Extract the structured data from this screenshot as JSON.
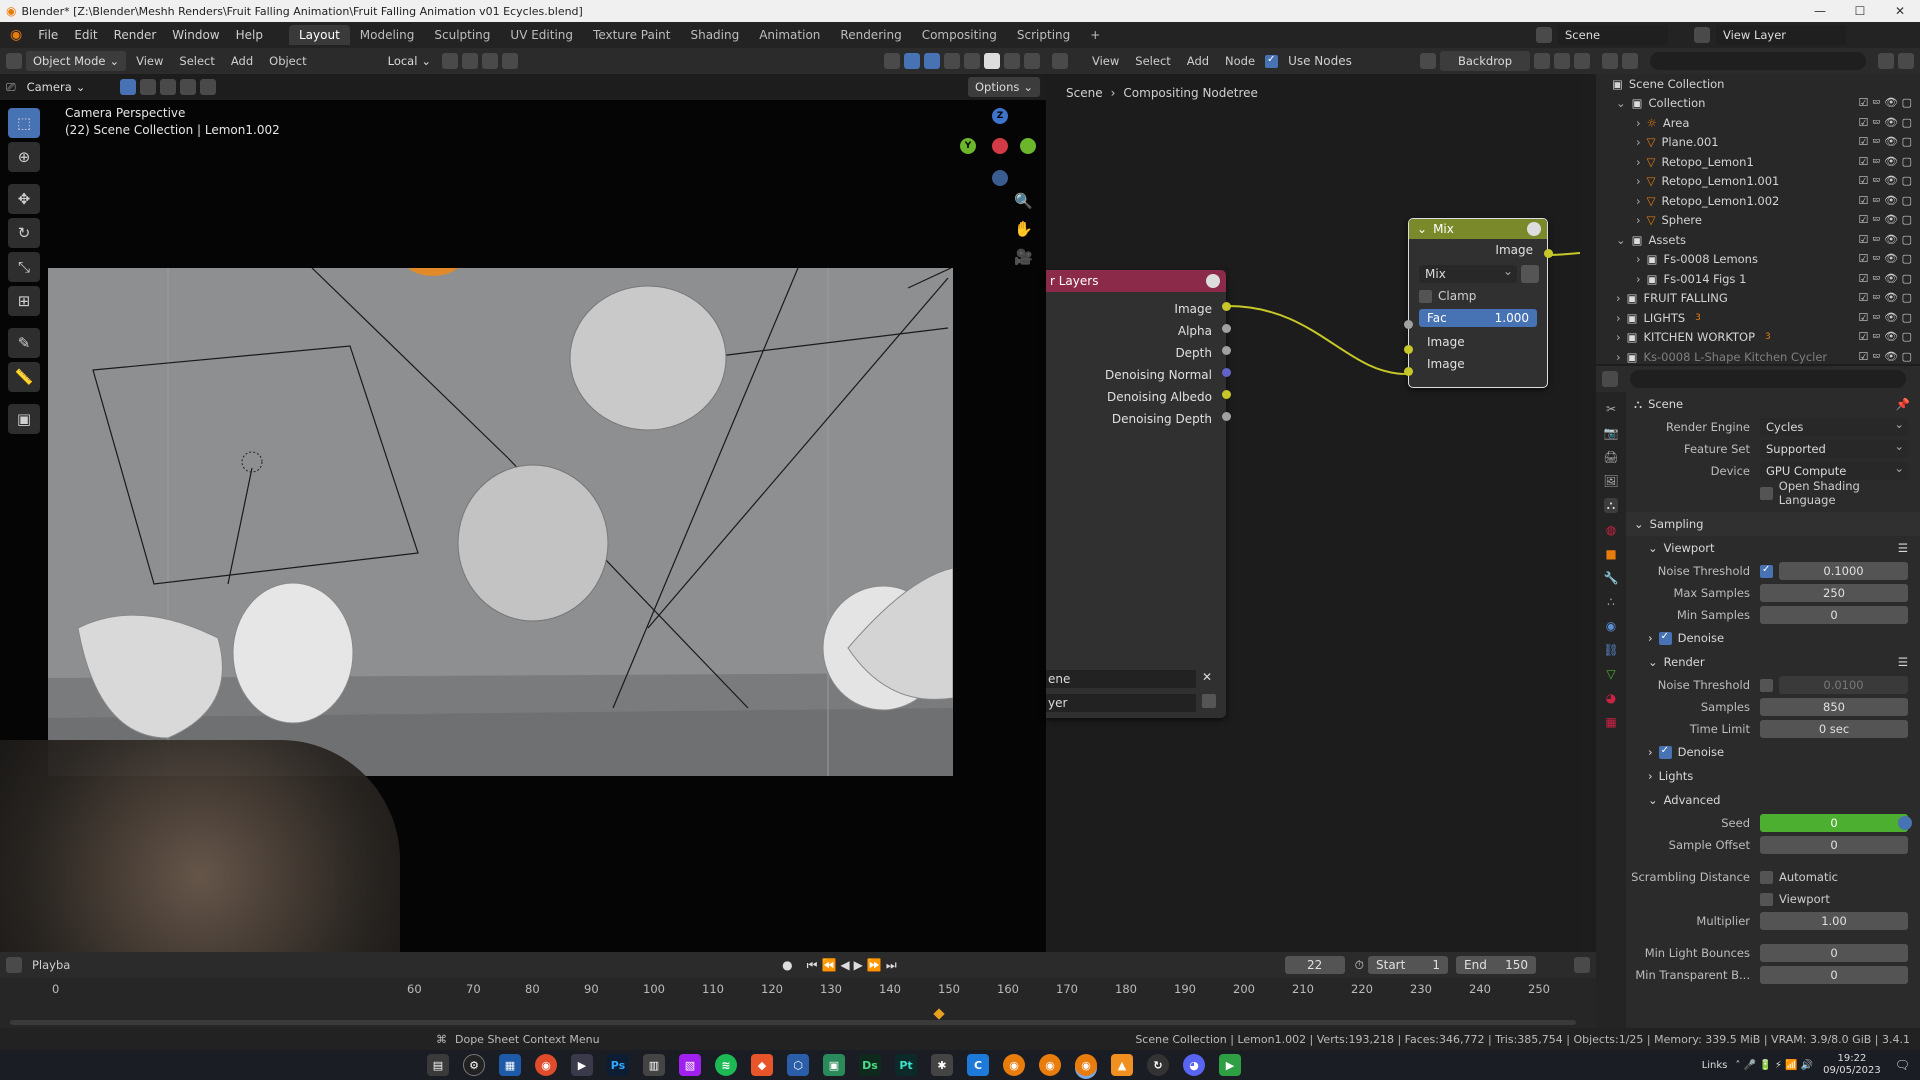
{
  "title_bar": {
    "text": "Blender* [Z:\\Blender\\Meshh Renders\\Fruit Falling Animation\\Fruit Falling Animation v01 Ecycles.blend]"
  },
  "menu": {
    "items": [
      "File",
      "Edit",
      "Render",
      "Window",
      "Help"
    ],
    "workspaces": [
      "Layout",
      "Modeling",
      "Sculpting",
      "UV Editing",
      "Texture Paint",
      "Shading",
      "Animation",
      "Rendering",
      "Compositing",
      "Scripting",
      "+"
    ],
    "scene": "Scene",
    "view_layer": "View Layer"
  },
  "viewport_header": {
    "mode": "Object Mode",
    "menus": [
      "View",
      "Select",
      "Add",
      "Object"
    ],
    "transform": "Local",
    "camera": "Camera",
    "options": "Options"
  },
  "viewport": {
    "overlay_line1": "Camera Perspective",
    "overlay_line2": "(22) Scene Collection | Lemon1.002",
    "gizmo": {
      "z": "Z",
      "y": "Y"
    }
  },
  "node_editor": {
    "menus": [
      "View",
      "Select",
      "Add",
      "Node"
    ],
    "use_nodes": "Use Nodes",
    "backdrop": "Backdrop",
    "breadcrumb": [
      "Scene",
      "Compositing Nodetree"
    ],
    "render_layers": {
      "title": "r Layers",
      "outputs": [
        "Image",
        "Alpha",
        "Depth",
        "Denoising Normal",
        "Denoising Albedo",
        "Denoising Depth"
      ],
      "scene_field": "ene",
      "layer_field": "yer"
    },
    "mix": {
      "title": "Mix",
      "output": "Image",
      "blend": "Mix",
      "clamp": "Clamp",
      "fac_label": "Fac",
      "fac_value": "1.000",
      "inputs": [
        "Image",
        "Image"
      ]
    }
  },
  "outliner": {
    "root": "Scene Collection",
    "rows": [
      {
        "label": "Collection",
        "depth": 0,
        "kind": "collection"
      },
      {
        "label": "Area",
        "depth": 1,
        "kind": "light"
      },
      {
        "label": "Plane.001",
        "depth": 1,
        "kind": "mesh"
      },
      {
        "label": "Retopo_Lemon1",
        "depth": 1,
        "kind": "mesh"
      },
      {
        "label": "Retopo_Lemon1.001",
        "depth": 1,
        "kind": "mesh"
      },
      {
        "label": "Retopo_Lemon1.002",
        "depth": 1,
        "kind": "mesh"
      },
      {
        "label": "Sphere",
        "depth": 1,
        "kind": "mesh"
      },
      {
        "label": "Assets",
        "depth": 0,
        "kind": "collection"
      },
      {
        "label": "Fs-0008 Lemons",
        "depth": 1,
        "kind": "collection"
      },
      {
        "label": "Fs-0014 Figs 1",
        "depth": 1,
        "kind": "collection"
      },
      {
        "label": "FRUIT FALLING",
        "depth": 0,
        "kind": "collection"
      },
      {
        "label": "LIGHTS",
        "depth": 0,
        "kind": "collection",
        "badge": "3"
      },
      {
        "label": "KITCHEN WORKTOP",
        "depth": 0,
        "kind": "collection",
        "badge": "3"
      },
      {
        "label": "Ks-0008 L-Shape Kitchen Cycler",
        "depth": 0,
        "kind": "collection"
      }
    ]
  },
  "properties": {
    "header": "Scene",
    "render_engine": {
      "label": "Render Engine",
      "value": "Cycles"
    },
    "feature_set": {
      "label": "Feature Set",
      "value": "Supported"
    },
    "device": {
      "label": "Device",
      "value": "GPU Compute"
    },
    "osl": "Open Shading Language",
    "sampling": "Sampling",
    "viewport": {
      "title": "Viewport",
      "noise_threshold_label": "Noise Threshold",
      "noise_threshold": "0.1000",
      "max_samples_label": "Max Samples",
      "max_samples": "250",
      "min_samples_label": "Min Samples",
      "min_samples": "0",
      "denoise": "Denoise"
    },
    "render": {
      "title": "Render",
      "noise_threshold_label": "Noise Threshold",
      "noise_threshold": "0.0100",
      "samples_label": "Samples",
      "samples": "850",
      "time_limit_label": "Time Limit",
      "time_limit": "0 sec",
      "denoise": "Denoise"
    },
    "lights": "Lights",
    "advanced": {
      "title": "Advanced",
      "seed_label": "Seed",
      "seed": "0",
      "sample_offset_label": "Sample Offset",
      "sample_offset": "0",
      "scrambling_label": "Scrambling Distance",
      "automatic": "Automatic",
      "viewport": "Viewport",
      "multiplier_label": "Multiplier",
      "multiplier": "1.00",
      "min_light_bounces_label": "Min Light Bounces",
      "min_light_bounces": "0",
      "min_transparent_label": "Min Transparent B...",
      "min_transparent": "0"
    }
  },
  "timeline": {
    "playback": "Playba",
    "current_frame": "22",
    "start_label": "Start",
    "start": "1",
    "end_label": "End",
    "end": "150",
    "ticks": [
      "0",
      "60",
      "70",
      "80",
      "90",
      "100",
      "110",
      "120",
      "130",
      "140",
      "150",
      "160",
      "170",
      "180",
      "190",
      "200",
      "210",
      "220",
      "230",
      "240",
      "250"
    ]
  },
  "status_bar": {
    "left": "Dope Sheet Context Menu",
    "right": "Scene Collection | Lemon1.002 | Verts:193,218 | Faces:346,772 | Tris:385,754 | Objects:1/25 | Memory: 339.5 MiB | VRAM: 3.9/8.0 GiB | 3.4.1"
  },
  "taskbar": {
    "apps": [
      "Ps",
      "Ds",
      "Pt"
    ],
    "tray_label": "Links",
    "time": "19:22",
    "date": "09/05/2023"
  },
  "colors": {
    "accent": "#4772b3",
    "node_mix_header": "#7a8a2a",
    "node_render_header": "#8c2a4a",
    "seed_green": "#4caf30",
    "socket_yellow": "#c7c729",
    "socket_purple": "#6363c7"
  }
}
